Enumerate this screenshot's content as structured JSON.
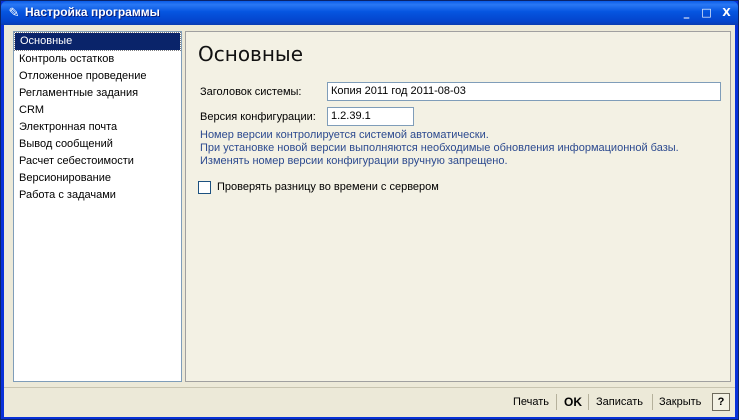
{
  "window": {
    "title": "Настройка программы",
    "minimize_glyph": "_",
    "maximize_glyph": "□",
    "close_glyph": "X"
  },
  "sidebar": {
    "items": [
      {
        "label": "Основные",
        "active": true
      },
      {
        "label": "Контроль остатков"
      },
      {
        "label": "Отложенное проведение"
      },
      {
        "label": "Регламентные задания"
      },
      {
        "label": "CRM"
      },
      {
        "label": "Электронная почта"
      },
      {
        "label": "Вывод сообщений"
      },
      {
        "label": "Расчет себестоимости"
      },
      {
        "label": "Версионирование"
      },
      {
        "label": "Работа с задачами"
      }
    ]
  },
  "main": {
    "title": "Основные",
    "system_title_label": "Заголовок системы:",
    "system_title_value": "Копия 2011 год 2011-08-03",
    "config_version_label": "Версия конфигурации:",
    "config_version_value": "1.2.39.1",
    "notes": [
      "Номер версии контролируется системой автоматически.",
      "При установке новой версии выполняются необходимые обновления информационной базы.",
      "Изменять номер версии конфигурации вручную запрещено."
    ],
    "check_time_label": "Проверять разницу во времени с сервером",
    "check_time_checked": false
  },
  "footer": {
    "print_label": "Печать",
    "ok_label": "OK",
    "save_label": "Записать",
    "close_label": "Закрыть",
    "help_label": "?"
  }
}
